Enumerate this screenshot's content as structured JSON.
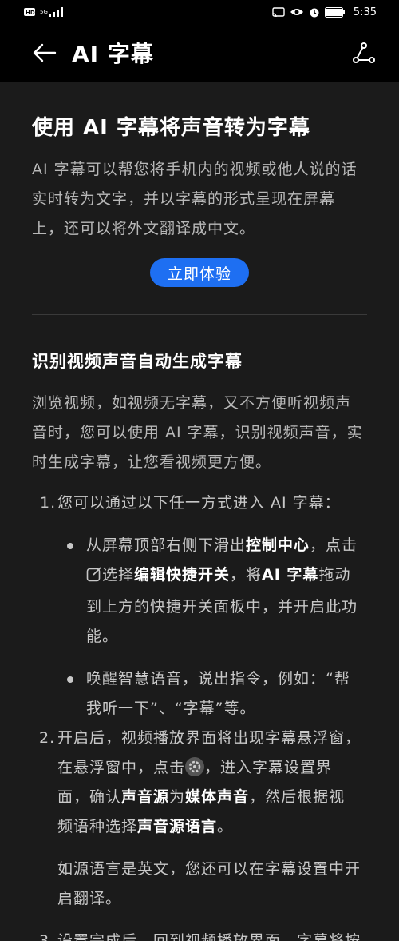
{
  "status": {
    "network": "5G",
    "time": "5:35"
  },
  "header": {
    "title": "AI 字幕"
  },
  "hero": {
    "title": "使用 AI 字幕将声音转为字幕",
    "lines": [
      "AI 字幕可以帮您将手机内的视频或他人说的话",
      "实时转为文字，并以字幕的形式呈现在屏幕",
      "上，还可以将外文翻译成中文。"
    ],
    "cta_label": "立即体验"
  },
  "section": {
    "title": "识别视频声音自动生成字幕",
    "para_lines": [
      "浏览视频，如视频无字幕，又不方便听视频声",
      "音时，您可以使用 AI 字幕，识别视频声音，实",
      "时生成字幕，让您看视频更方便。"
    ],
    "step1": {
      "num": "1.",
      "text": "您可以通过以下任一方式进入 AI 字幕："
    },
    "bullet1": {
      "l1a": "从屏幕顶部右侧下滑出",
      "l1b": "控制中心",
      "l1c": "，点击",
      "l2a": "选择",
      "l2b": "编辑快捷开关",
      "l2c": "，将",
      "l2d": "AI 字幕",
      "l2e": "拖动",
      "l3": "到上方的快捷开关面板中，并开启此功",
      "l4": "能。"
    },
    "bullet2": {
      "l1": "唤醒智慧语音，说出指令，例如：“帮",
      "l2": "我听一下”、“字幕”等。"
    },
    "step2": {
      "num": "2.",
      "l1": "开启后，视频播放界面将出现字幕悬浮窗，",
      "l2a": "在悬浮窗中，点击",
      "l2b": "，进入字幕设置界",
      "l3a": "面，确认",
      "l3b": "声音源",
      "l3c": "为",
      "l3d": "媒体声音",
      "l3e": "，然后根据视",
      "l4a": "频语种选择",
      "l4b": "声音源语言",
      "l4c": "。",
      "note_l1": "如源语言是英文，您还可以在字幕设置中开",
      "note_l2": "启翻译。"
    },
    "step3": {
      "num": "3.",
      "text": "设置完成后，回到视频播放界面，字幕将按"
    }
  },
  "colors": {
    "background": "#1b1b1b",
    "accent": "#1e6ff2"
  }
}
